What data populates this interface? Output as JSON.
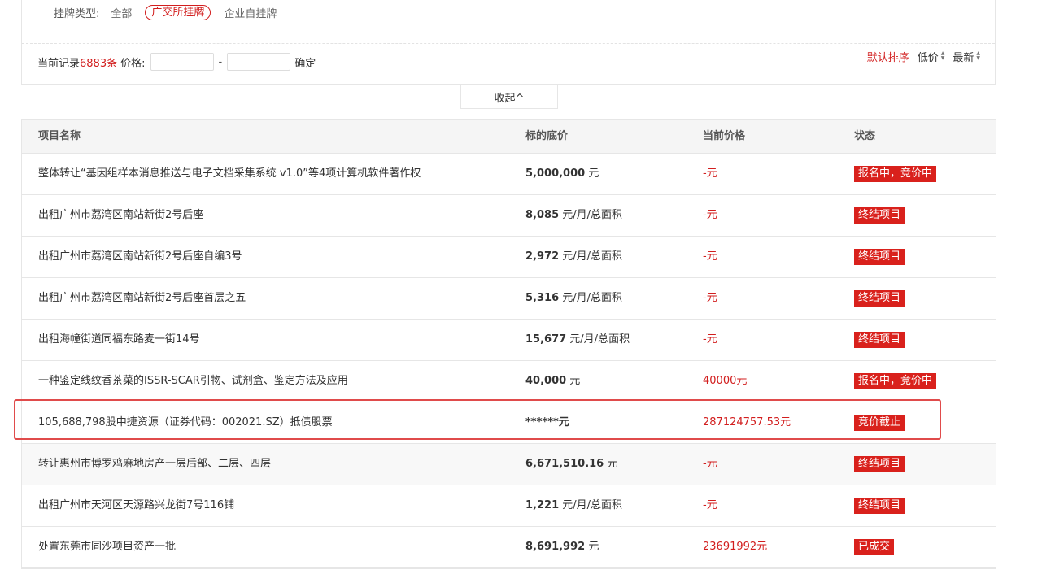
{
  "filter": {
    "type_label": "挂牌类型:",
    "types": [
      "全部",
      "广交所挂牌",
      "企业自挂牌"
    ],
    "record_prefix": "当前记录",
    "record_count": "6883条",
    "price_label": "价格:",
    "price_min": "",
    "price_max": "",
    "dash": "-",
    "confirm": "确定",
    "sort_default": "默认排序",
    "sort_price": "低价",
    "sort_new": "最新",
    "collapse": "收起^"
  },
  "table": {
    "headers": [
      "项目名称",
      "标的底价",
      "当前价格",
      "状态"
    ],
    "rows": [
      {
        "name": "整体转让“基因组样本消息推送与电子文档采集系统 v1.0”等4项计算机软件著作权",
        "price_num": "5,000,000",
        "price_unit": " 元",
        "current": "-元",
        "status": "报名中，竞价中"
      },
      {
        "name": "出租广州市荔湾区南站新街2号后座",
        "price_num": "8,085",
        "price_unit": " 元/月/总面积",
        "current": "-元",
        "status": "终结项目"
      },
      {
        "name": "出租广州市荔湾区南站新街2号后座自编3号",
        "price_num": "2,972",
        "price_unit": " 元/月/总面积",
        "current": "-元",
        "status": "终结项目"
      },
      {
        "name": "出租广州市荔湾区南站新街2号后座首层之五",
        "price_num": "5,316",
        "price_unit": " 元/月/总面积",
        "current": "-元",
        "status": "终结项目"
      },
      {
        "name": "出租海幢街道同福东路麦一街14号",
        "price_num": "15,677",
        "price_unit": " 元/月/总面积",
        "current": "-元",
        "status": "终结项目"
      },
      {
        "name": "一种鉴定线纹香茶菜的ISSR-SCAR引物、试剂盒、鉴定方法及应用",
        "price_num": "40,000",
        "price_unit": " 元",
        "current": "40000元",
        "status": "报名中，竞价中"
      },
      {
        "name": "105,688,798股中捷资源（证券代码：002021.SZ）抵债股票",
        "price_num": "******元",
        "price_unit": "",
        "current": "287124757.53元",
        "status": "竞价截止"
      },
      {
        "name": "转让惠州市博罗鸡麻地房产一层后部、二层、四层",
        "price_num": "6,671,510.16",
        "price_unit": " 元",
        "current": "-元",
        "status": "终结项目"
      },
      {
        "name": "出租广州市天河区天源路兴龙街7号116铺",
        "price_num": "1,221",
        "price_unit": " 元/月/总面积",
        "current": "-元",
        "status": "终结项目"
      },
      {
        "name": "处置东莞市同沙项目资产一批",
        "price_num": "8,691,992",
        "price_unit": " 元",
        "current": "23691992元",
        "status": "已成交"
      }
    ]
  }
}
